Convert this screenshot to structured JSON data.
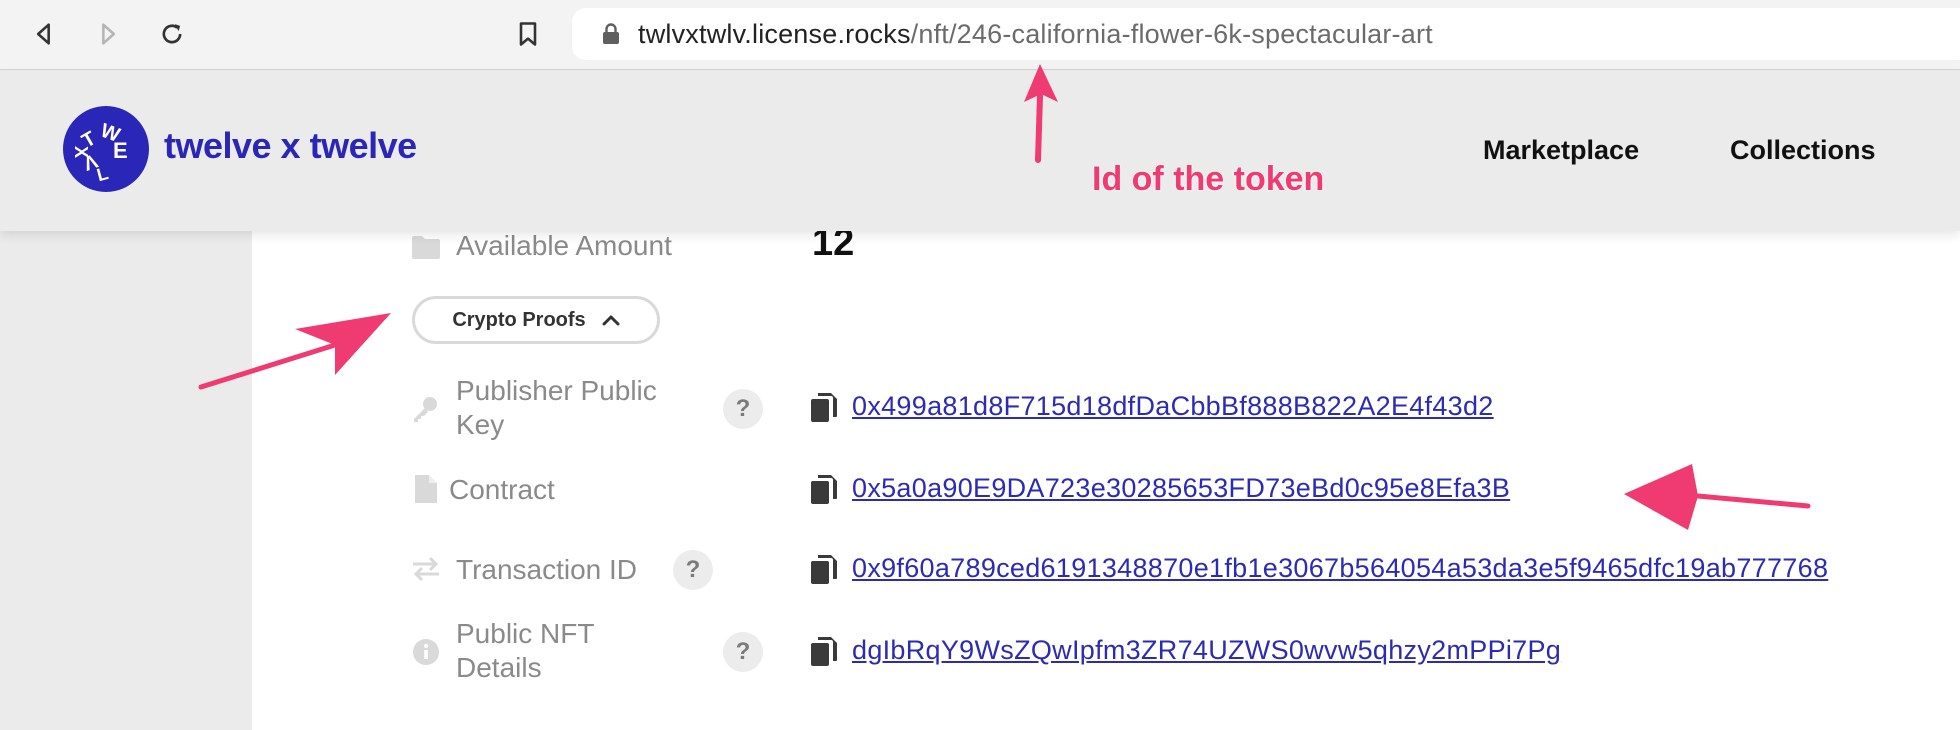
{
  "browser": {
    "url_host": "twlvxtwlv.license.rocks",
    "url_path": "/nft/246-california-flower-6k-spectacular-art"
  },
  "header": {
    "brand": "twelve x twelve",
    "nav": [
      "Marketplace",
      "Collections"
    ]
  },
  "details": {
    "available_amount": {
      "label": "Available Amount",
      "value": "12"
    },
    "crypto_proofs_label": "Crypto Proofs",
    "rows": [
      {
        "label_line1": "Publisher Public",
        "label_line2": "Key",
        "value": "0x499a81d8F715d18dfDaCbbBf888B822A2E4f43d2"
      },
      {
        "label_line1": "Contract",
        "value": "0x5a0a90E9DA723e30285653FD73eBd0c95e8Efa3B"
      },
      {
        "label_line1": "Transaction ID",
        "value": "0x9f60a789ced6191348870e1fb1e3067b564054a53da3e5f9465dfc19ab777768"
      },
      {
        "label_line1": "Public NFT",
        "label_line2": "Details",
        "value": "dgIbRqY9WsZQwIpfm3ZR74UZWS0wvw5qhzy2mPPi7Pg"
      }
    ]
  },
  "annotation": {
    "text": "Id of the token"
  },
  "colors": {
    "brand": "#2a27b8",
    "link": "#2b2bb5",
    "annotation": "#f03a72"
  }
}
